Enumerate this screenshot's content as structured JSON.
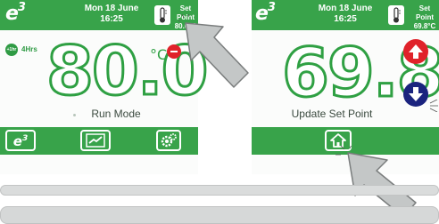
{
  "left_screen": {
    "logo": "e",
    "logo_sup": "3",
    "date": "Mon 18 June",
    "time": "16:25",
    "setpoint_label": "Set Point",
    "setpoint_value": "80.0°C",
    "boost_badge": "+1hr",
    "boost_duration": "4Hrs",
    "temperature": "80.0",
    "unit": "°C",
    "mode_label": "Run Mode",
    "bottom_buttons": [
      "e3-home-button",
      "graph-button",
      "settings-button"
    ]
  },
  "right_screen": {
    "logo": "e",
    "logo_sup": "3",
    "date": "Mon 18 June",
    "time": "16:25",
    "setpoint_label": "Set Point",
    "setpoint_value": "69.8°C",
    "temperature": "69.8",
    "mode_label": "Update Set Point",
    "bottom_buttons": [
      "home-button"
    ]
  },
  "colors": {
    "brand_green": "#38a34a",
    "digit_green": "#2fa043",
    "up_red": "#e0222a",
    "down_navy": "#1a237e",
    "pointer_gray": "#c4c7c7"
  },
  "icons": [
    "thermometer-icon",
    "minus-icon",
    "arrow-up-icon",
    "arrow-down-icon",
    "graph-icon",
    "gear-icon",
    "house-icon",
    "pointer-arrow-icon"
  ]
}
